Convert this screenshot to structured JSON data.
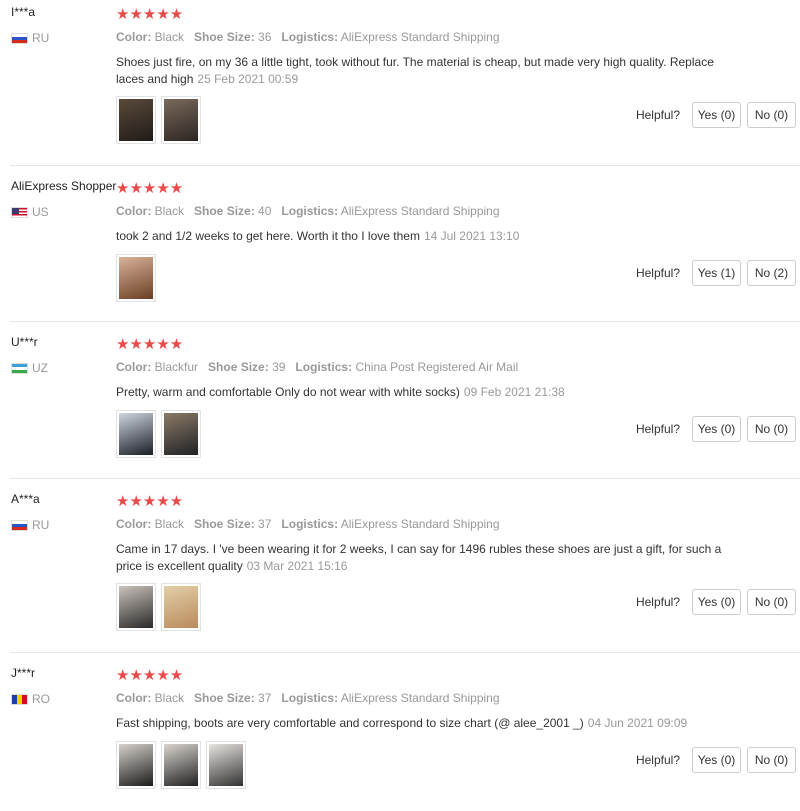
{
  "ui": {
    "helpful_label": "Helpful?",
    "attr_labels": {
      "color": "Color:",
      "shoe_size": "Shoe Size:",
      "logistics": "Logistics:"
    },
    "star_color": "#e94b4b",
    "star_glyph": "★★★★★"
  },
  "reviews": [
    {
      "user": "I***a",
      "country": "RU",
      "rating": 5,
      "color": "Black",
      "shoe_size": "36",
      "logistics": "AliExpress Standard Shipping",
      "text": "Shoes just fire, on my 36 a little tight, took without fur. The material is cheap, but made very high quality. Replace laces and high",
      "date": "25 Feb 2021 00:59",
      "photos": [
        {
          "icon": "boot-photo-thumbnail",
          "colors": [
            "#5a4a3a",
            "#1f1b18"
          ]
        },
        {
          "icon": "boot-photo-thumbnail",
          "colors": [
            "#7a6a5a",
            "#2b2522"
          ]
        }
      ],
      "yes": "Yes (0)",
      "no": "No (0)"
    },
    {
      "user": "AliExpress Shopper",
      "country": "US",
      "rating": 5,
      "color": "Black",
      "shoe_size": "40",
      "logistics": "AliExpress Standard Shipping",
      "text": "took 2 and 1/2 weeks to get here. Worth it tho I love them",
      "date": "14 Jul 2021 13:10",
      "photos": [
        {
          "icon": "selfie-photo-thumbnail",
          "colors": [
            "#d8b39a",
            "#6b3e24"
          ]
        }
      ],
      "yes": "Yes (1)",
      "no": "No (2)"
    },
    {
      "user": "U***r",
      "country": "UZ",
      "rating": 5,
      "color": "Blackfur",
      "shoe_size": "39",
      "logistics": "China Post Registered Air Mail",
      "text": "Pretty, warm and comfortable Only do not wear with white socks)",
      "date": "09 Feb 2021 21:38",
      "photos": [
        {
          "icon": "boot-photo-thumbnail",
          "colors": [
            "#cfd6e0",
            "#1a1d24"
          ]
        },
        {
          "icon": "boot-photo-thumbnail",
          "colors": [
            "#8a7a66",
            "#202226"
          ]
        }
      ],
      "yes": "Yes (0)",
      "no": "No (0)"
    },
    {
      "user": "A***a",
      "country": "RU",
      "rating": 5,
      "color": "Black",
      "shoe_size": "37",
      "logistics": "AliExpress Standard Shipping",
      "text": "Came in 17 days. I 've been wearing it for 2 weeks, I can say for 1496 rubles these shoes are just a gift, for such a price is excellent quality",
      "date": "03 Mar 2021 15:16",
      "photos": [
        {
          "icon": "boot-photo-thumbnail",
          "colors": [
            "#c9c3bd",
            "#2a2827"
          ]
        },
        {
          "icon": "boot-photo-thumbnail",
          "colors": [
            "#e2cfa8",
            "#b98a5b"
          ]
        }
      ],
      "yes": "Yes (0)",
      "no": "No (0)"
    },
    {
      "user": "J***r",
      "country": "RO",
      "rating": 5,
      "color": "Black",
      "shoe_size": "37",
      "logistics": "AliExpress Standard Shipping",
      "text": "Fast shipping, boots are very comfortable and correspond to size chart (@ alee_2001 _)",
      "date": "04 Jun 2021 09:09",
      "photos": [
        {
          "icon": "boot-photo-thumbnail",
          "colors": [
            "#d6d1cc",
            "#1c1c1c"
          ]
        },
        {
          "icon": "boot-photo-thumbnail",
          "colors": [
            "#d9d4cf",
            "#222"
          ]
        },
        {
          "icon": "boot-photo-thumbnail",
          "colors": [
            "#e8e4e0",
            "#333"
          ]
        }
      ],
      "yes": "Yes (0)",
      "no": "No (0)"
    }
  ]
}
